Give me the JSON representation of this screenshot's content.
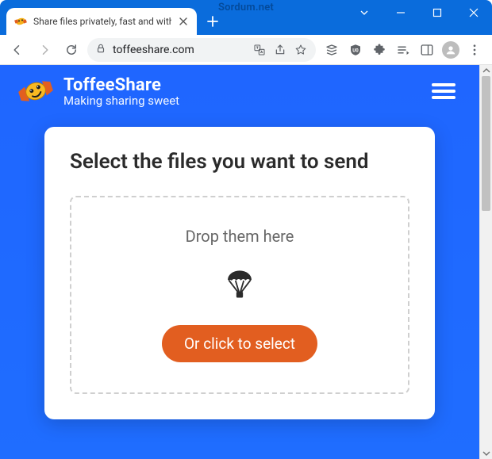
{
  "window": {
    "overlay_text": "Sordum.net"
  },
  "tab": {
    "title": "Share files privately, fast and with"
  },
  "address": {
    "url": "toffeeshare.com"
  },
  "site": {
    "brand": "ToffeeShare",
    "tagline": "Making sharing sweet"
  },
  "main": {
    "heading": "Select the files you want to send",
    "drop_hint": "Drop them here",
    "select_label": "Or click to select"
  },
  "colors": {
    "accent": "#e25e20",
    "page_bg": "#1f6dff",
    "chrome": "#0a6cdc"
  }
}
